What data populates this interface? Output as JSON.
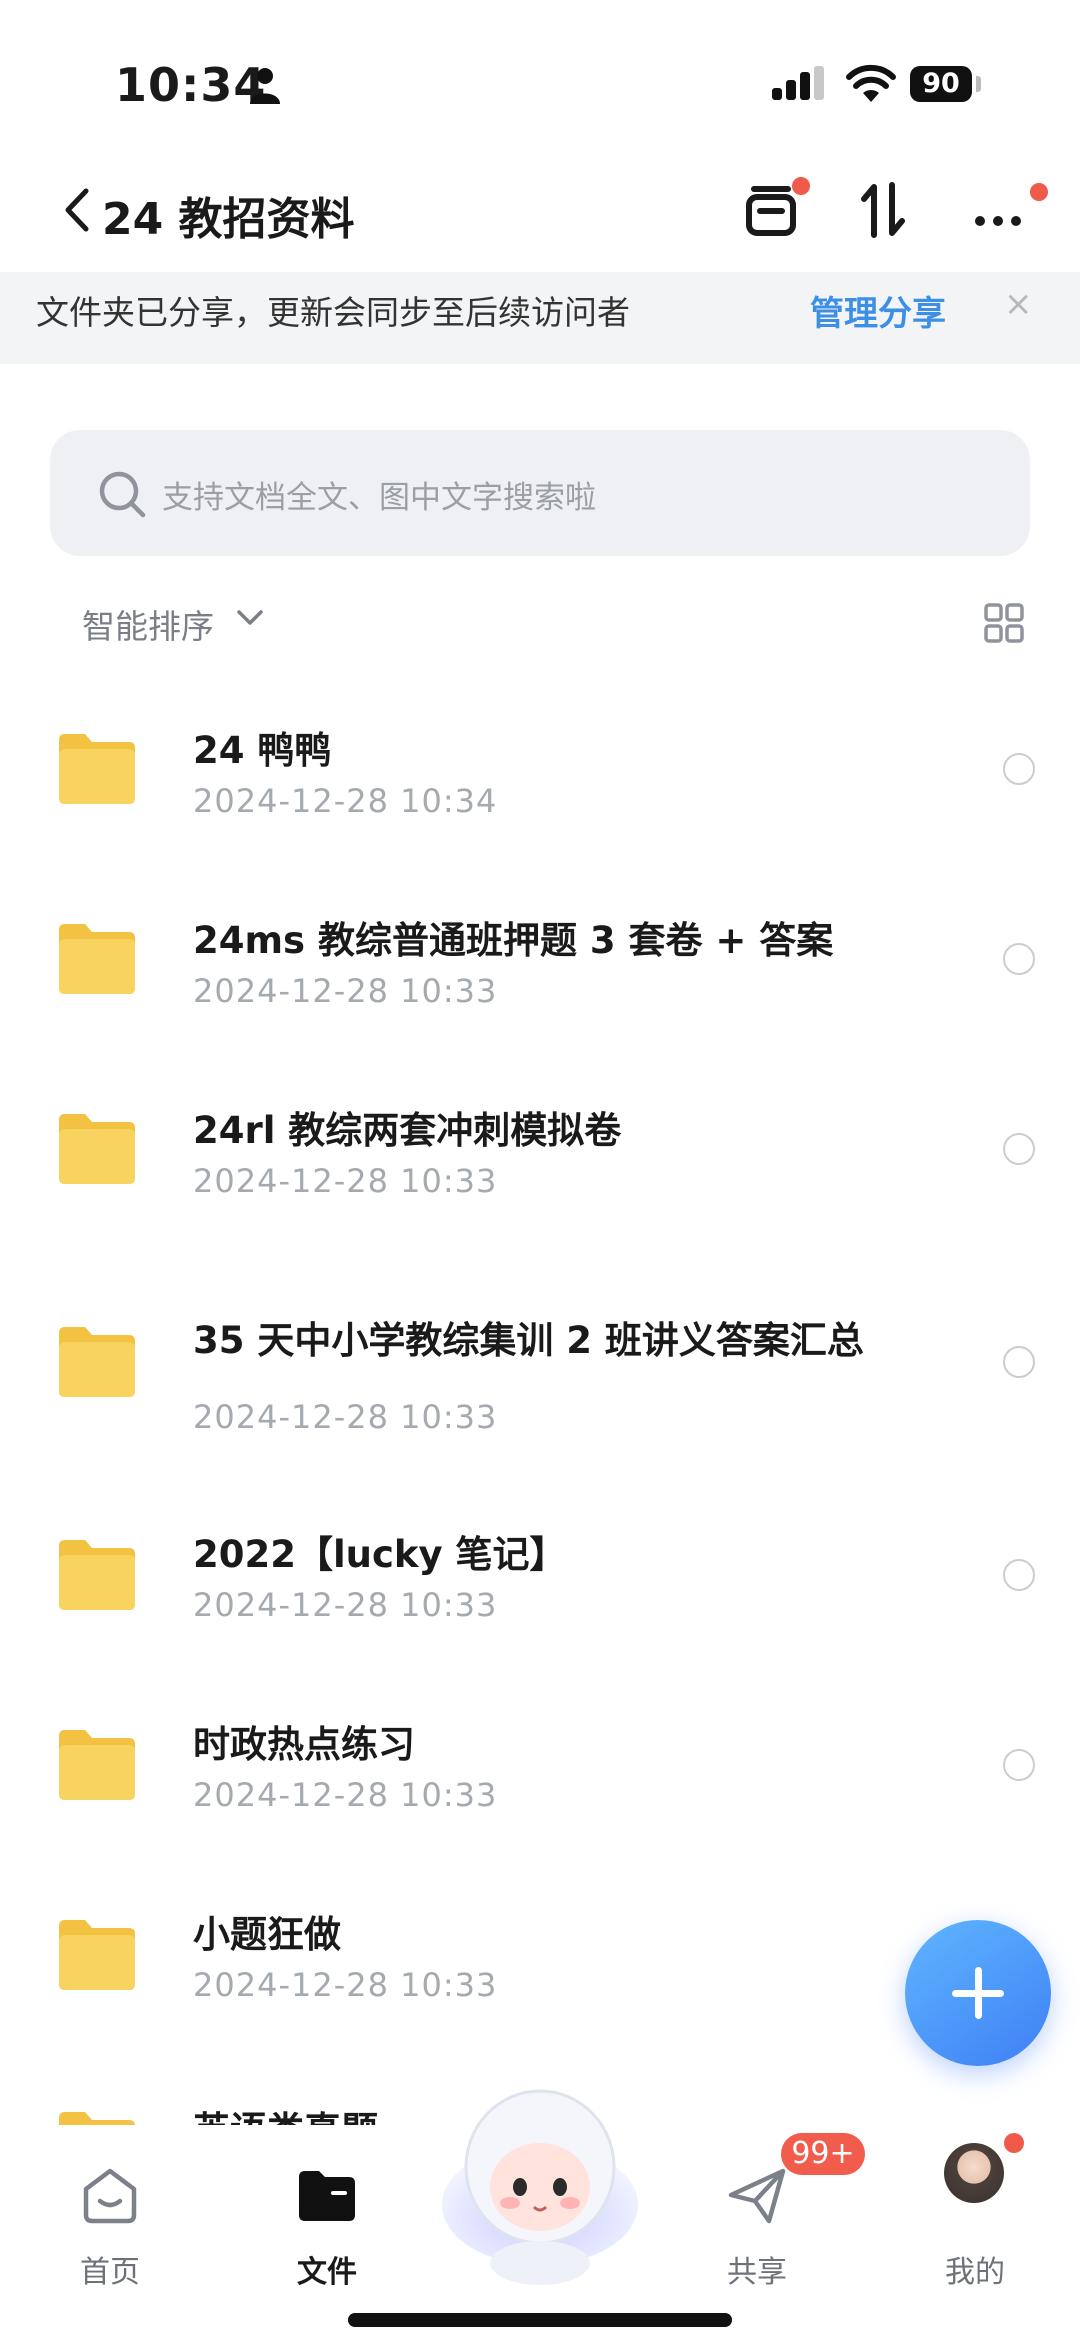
{
  "status_bar": {
    "time": "10:34",
    "battery": "90"
  },
  "nav": {
    "title": "24 教招资料"
  },
  "share_banner": {
    "text": "文件夹已分享，更新会同步至后续访问者",
    "link": "管理分享",
    "close": "×"
  },
  "search": {
    "placeholder": "支持文档全文、图中文字搜索啦"
  },
  "sort": {
    "label": "智能排序"
  },
  "files": [
    {
      "name": "24 鸭鸭",
      "date": "2024-12-28 10:34"
    },
    {
      "name": "24ms 教综普通班押题 3 套卷 + 答案",
      "date": "2024-12-28 10:33"
    },
    {
      "name": "24rl 教综两套冲刺模拟卷",
      "date": "2024-12-28 10:33"
    },
    {
      "name": "35 天中小学教综集训 2 班讲义答案汇总",
      "date": "2024-12-28 10:33"
    },
    {
      "name": "2022【lucky 笔记】",
      "date": "2024-12-28 10:33"
    },
    {
      "name": "时政热点练习",
      "date": "2024-12-28 10:33"
    },
    {
      "name": "小题狂做",
      "date": "2024-12-28 10:33"
    },
    {
      "name": "英语类真题",
      "date": ""
    }
  ],
  "tabs": [
    {
      "label": "首页",
      "icon": "home-icon"
    },
    {
      "label": "文件",
      "icon": "folder-icon"
    },
    {
      "label": "",
      "icon": "mascot-assistant"
    },
    {
      "label": "共享",
      "icon": "paper-plane-icon"
    },
    {
      "label": "我的",
      "icon": "avatar"
    }
  ],
  "share_badge": "99+",
  "colors": {
    "accent": "#3d8fe6",
    "folder": "#f8cf4f",
    "badge": "#f25c4d",
    "fab": "#4f93f7"
  }
}
